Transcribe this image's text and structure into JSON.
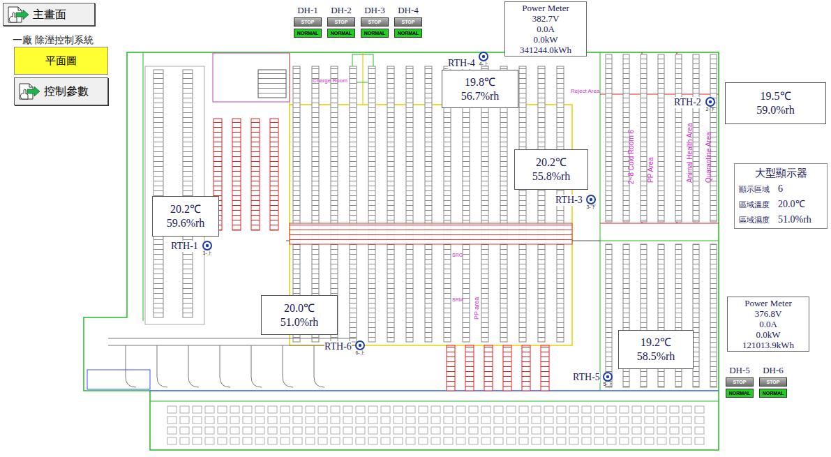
{
  "home_button": {
    "label": "主畫面"
  },
  "system_title": "一廠 除溼控制系統",
  "pages": [
    {
      "label": "平面圖",
      "selected": true
    },
    {
      "label": "控制參數",
      "selected": false
    }
  ],
  "dehumidifiers_top": [
    {
      "name": "DH-1",
      "run": "STOP",
      "state": "NORMAL"
    },
    {
      "name": "DH-2",
      "run": "STOP",
      "state": "NORMAL"
    },
    {
      "name": "DH-3",
      "run": "STOP",
      "state": "NORMAL"
    },
    {
      "name": "DH-4",
      "run": "STOP",
      "state": "NORMAL"
    }
  ],
  "dehumidifiers_right": [
    {
      "name": "DH-5",
      "run": "STOP",
      "state": "NORMAL"
    },
    {
      "name": "DH-6",
      "run": "STOP",
      "state": "NORMAL"
    }
  ],
  "power_meters": [
    {
      "title": "Power Meter",
      "voltage": "382.7V",
      "current": "0.0A",
      "power": "0.0kW",
      "energy": "341244.0kWh"
    },
    {
      "title": "Power Meter",
      "voltage": "376.8V",
      "current": "0.0A",
      "power": "0.0kW",
      "energy": "121013.9kWh"
    }
  ],
  "sensors": [
    {
      "name": "RTH-1",
      "tag": "1-上",
      "temperature": "20.2℃",
      "humidity": "59.6%rh"
    },
    {
      "name": "RTH-2",
      "tag": "2-下",
      "temperature": "19.5℃",
      "humidity": "59.0%rh"
    },
    {
      "name": "RTH-3",
      "tag": "3-下",
      "temperature": "20.2℃",
      "humidity": "55.8%rh"
    },
    {
      "name": "RTH-4",
      "tag": "4-上",
      "temperature": "19.8℃",
      "humidity": "56.7%rh"
    },
    {
      "name": "RTH-5",
      "tag": "5-上",
      "temperature": "19.2℃",
      "humidity": "58.5%rh"
    },
    {
      "name": "RTH-6",
      "tag": "6-上",
      "temperature": "20.0℃",
      "humidity": "51.0%rh"
    }
  ],
  "large_display": {
    "title": "大型顯示器",
    "rows": [
      {
        "label": "顯示區域",
        "value": "6"
      },
      {
        "label": "區域溫度",
        "value": "20.0℃"
      },
      {
        "label": "區域濕度",
        "value": "51.0%rh"
      }
    ]
  },
  "floor_labels": [
    "Charge Room",
    "Reject Area",
    "2~8 Cold Room 6",
    "PP Area",
    "Animal Health Area",
    "Quarantine Area",
    "PP area",
    "SRG",
    "SRM"
  ]
}
